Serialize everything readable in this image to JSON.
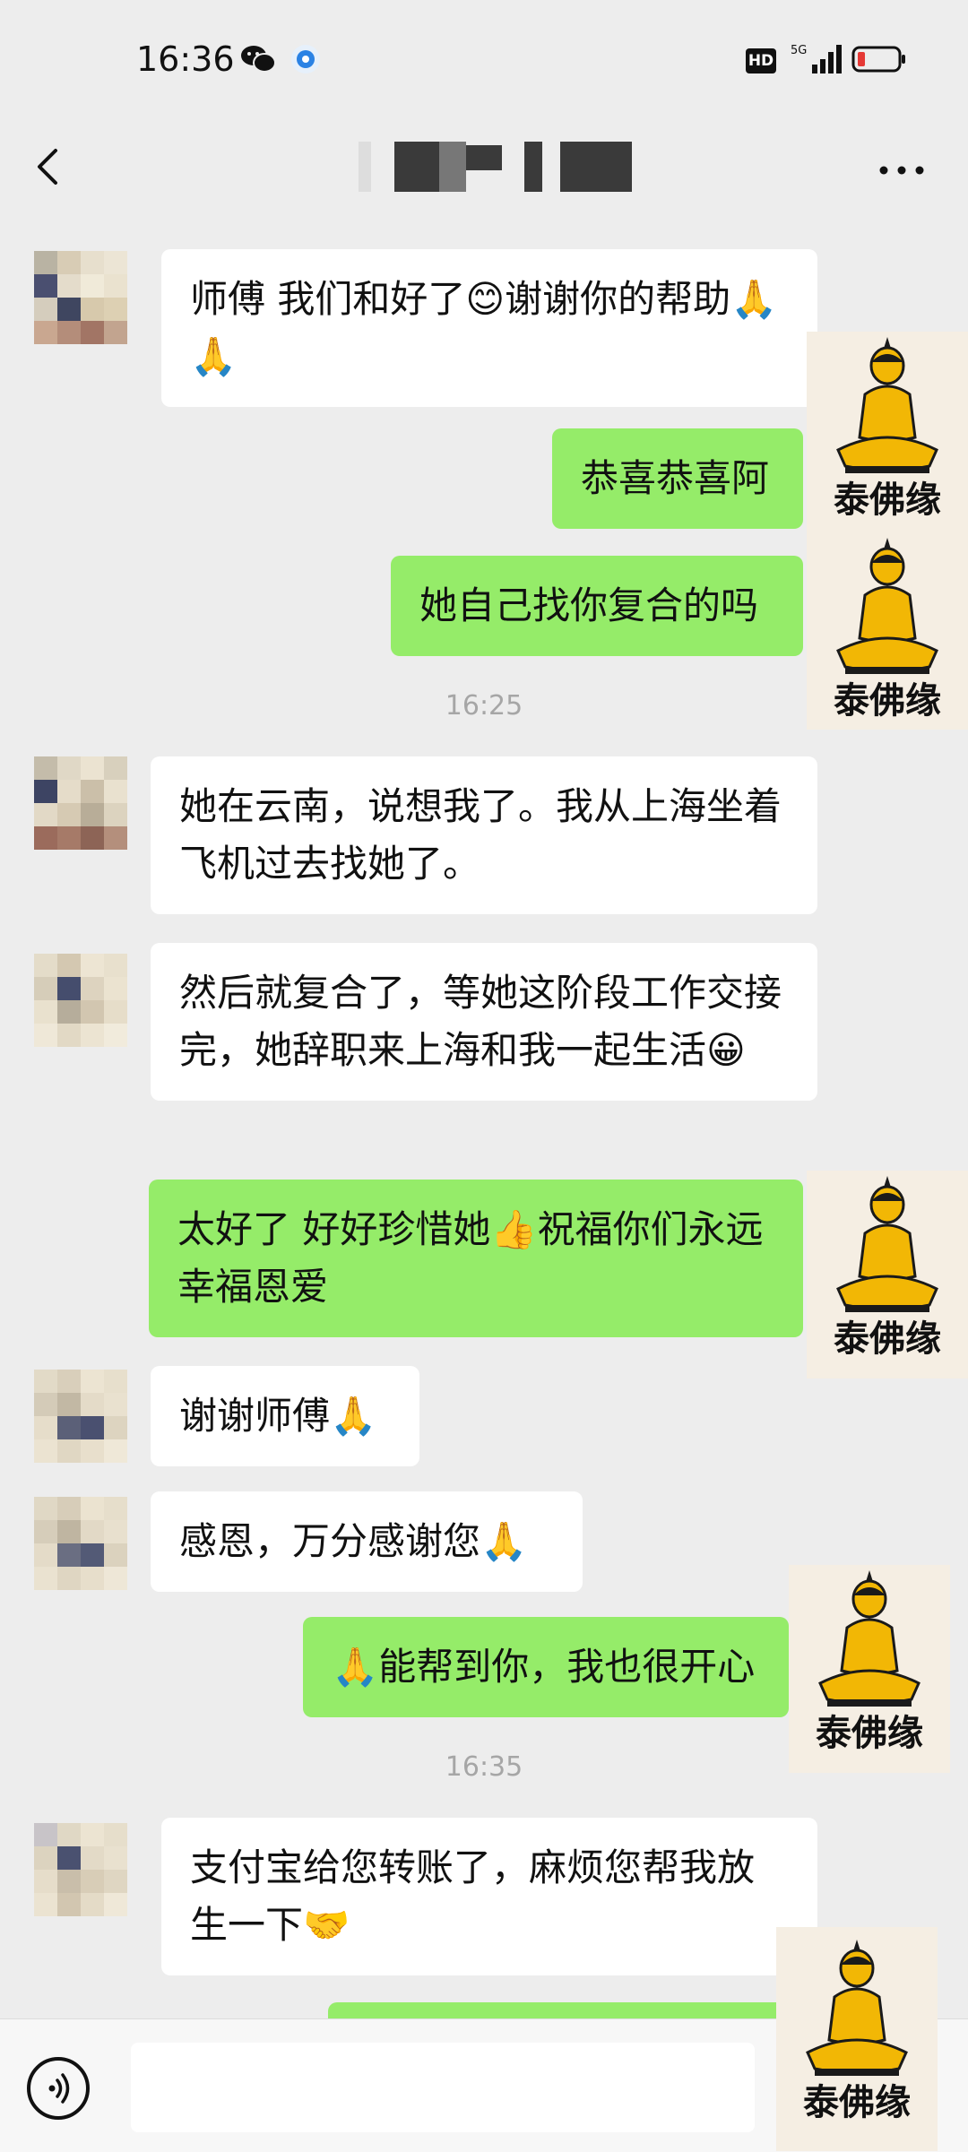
{
  "status": {
    "time": "16:36",
    "hd": "HD",
    "network": "5G"
  },
  "header": {
    "contact_name": ""
  },
  "stamp_text": "泰佛缘",
  "messages": [
    {
      "dir": "in",
      "text": "师傅 我们和好了😊谢谢你的帮助🙏🙏"
    },
    {
      "dir": "out",
      "text": "恭喜恭喜阿"
    },
    {
      "dir": "out",
      "text": "她自己找你复合的吗"
    },
    {
      "dir": "time",
      "text": "16:25"
    },
    {
      "dir": "in",
      "text": "她在云南，说想我了。我从上海坐着飞机过去找她了。"
    },
    {
      "dir": "in",
      "text": "然后就复合了，等她这阶段工作交接完，她辞职来上海和我一起生活😀"
    },
    {
      "dir": "out",
      "text": "太好了 好好珍惜她👍祝福你们永远幸福恩爱"
    },
    {
      "dir": "in",
      "text": "谢谢师傅🙏"
    },
    {
      "dir": "in",
      "text": "感恩，万分感谢您🙏"
    },
    {
      "dir": "out",
      "text": "🙏能帮到你，我也很开心"
    },
    {
      "dir": "time",
      "text": "16:35"
    },
    {
      "dir": "in",
      "text": "支付宝给您转账了，麻烦您帮我放生一下🤝"
    }
  ],
  "colors": {
    "background": "#ededed",
    "incoming": "#ffffff",
    "outgoing": "#95ec69",
    "timestamp": "#a6a6a6"
  },
  "icons": [
    "back-arrow-icon",
    "more-icon",
    "voice-icon",
    "wechat-icon",
    "signal-icon",
    "battery-icon"
  ]
}
